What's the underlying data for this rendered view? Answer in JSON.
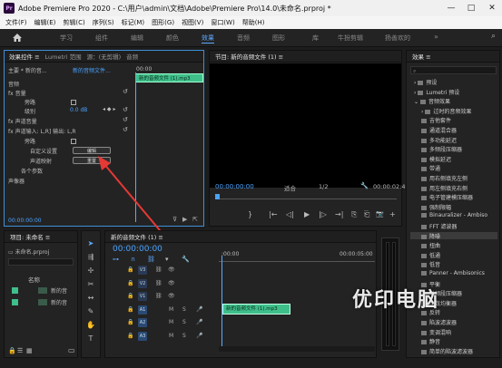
{
  "window": {
    "title": "Adobe Premiere Pro 2020 - C:\\用户\\admin\\文档\\Adobe\\Premiere Pro\\14.0\\未命名.prproj *",
    "logo_text": "Pr",
    "controls": [
      "—",
      "□",
      "✕"
    ]
  },
  "menu": [
    "文件(F)",
    "编辑(E)",
    "剪辑(C)",
    "序列(S)",
    "标记(M)",
    "图形(G)",
    "视图(V)",
    "窗口(W)",
    "帮助(H)"
  ],
  "workspaces": [
    "学习",
    "组件",
    "编辑",
    "颜色",
    "效果",
    "音频",
    "图形",
    "库",
    "牛扮剪辑",
    "扬善欢的"
  ],
  "active_workspace": "效果",
  "effect_controls": {
    "tabs": [
      "效果控件 ≡",
      "Lumetri 范围",
      "源：(无剪辑)",
      "音频"
    ],
    "master_dropdown": "主要 * 新的音...",
    "clip_dropdown": "新的音频文件...",
    "timecode_left": "00:00",
    "clip_bar_label": "新的音频文件 (1).mp3",
    "section_audio": "音频",
    "rows": {
      "volume": "fx 音量",
      "bypass": "旁路",
      "level_label": "级别",
      "level_value": "0.0 dB",
      "channel_volume": "fx 声道音量",
      "panner": "fx 声道输入: L,R] 输出: L,R",
      "bypass2": "旁路",
      "custom_setup": "自定义设置",
      "channel_map": "声道映射",
      "params": "各个参数",
      "panner2": "声像器"
    },
    "edit_button": "编辑",
    "reset_button": "重置",
    "timecode_bottom": "00:00:00:00"
  },
  "program_monitor": {
    "title": "节目: 新的音频文件 (1) ≡",
    "timecode": "00:00:00:00",
    "fit": "适合",
    "resolution": "1/2",
    "duration": "00:00:02:4",
    "controls": [
      "}",
      "|←",
      "◁|",
      "▶",
      "|▷",
      "→|",
      "⎘",
      "⎗",
      "📷",
      "+"
    ]
  },
  "effects_panel": {
    "title": "效果 ≡",
    "items": [
      {
        "label": "预设",
        "level": 0,
        "arrow": "›"
      },
      {
        "label": "Lumetri 预设",
        "level": 0,
        "arrow": "›"
      },
      {
        "label": "音频效果",
        "level": 0,
        "arrow": "⌄"
      },
      {
        "label": "过时的音频效果",
        "level": 1,
        "arrow": "›"
      },
      {
        "label": "吉他套件",
        "level": 1
      },
      {
        "label": "通道混合器",
        "level": 1
      },
      {
        "label": "多功能延迟",
        "level": 1
      },
      {
        "label": "多频段压缩器",
        "level": 1
      },
      {
        "label": "模拟延迟",
        "level": 1
      },
      {
        "label": "带通",
        "level": 1
      },
      {
        "label": "用右侧填充左侧",
        "level": 1
      },
      {
        "label": "用左侧填充右侧",
        "level": 1
      },
      {
        "label": "电子管建模压缩器",
        "level": 1
      },
      {
        "label": "强制限幅",
        "level": 1
      },
      {
        "label": "Binauralizer - Ambiso",
        "level": 1
      },
      {
        "label": "FFT 滤波器",
        "level": 1
      },
      {
        "label": "降噪",
        "level": 1,
        "selected": true
      },
      {
        "label": "扭曲",
        "level": 1
      },
      {
        "label": "低通",
        "level": 1
      },
      {
        "label": "低音",
        "level": 1
      },
      {
        "label": "Panner - Ambisonics",
        "level": 1
      },
      {
        "label": "平衡",
        "level": 1
      },
      {
        "label": "单频段压缩器",
        "level": 1
      },
      {
        "label": "参数均衡器",
        "level": 1
      },
      {
        "label": "反转",
        "level": 1
      },
      {
        "label": "陷波滤波器",
        "level": 1
      },
      {
        "label": "变调混响",
        "level": 1
      },
      {
        "label": "静音",
        "level": 1
      },
      {
        "label": "简单的陷波滤波器",
        "level": 1
      }
    ]
  },
  "project_panel": {
    "title": "项目: 未命名 ≡",
    "file": "未命名.prproj",
    "name_header": "名称",
    "items": [
      "新的音",
      "新的音"
    ]
  },
  "timeline": {
    "title": "新的音频文件 (1) ≡",
    "timecode": "00:00:00:00",
    "ruler_start": ":00:00",
    "ruler_end": "00:00:05:00",
    "tracks": [
      "V3",
      "V2",
      "V1",
      "A1",
      "A2",
      "A3"
    ],
    "clip_label": "新的音频文件 (1).mp3"
  },
  "watermark": "优印电脑",
  "colors": {
    "accent": "#5ea9ff",
    "clip_green": "#3fbf8a",
    "annotation_red": "#e53935"
  }
}
